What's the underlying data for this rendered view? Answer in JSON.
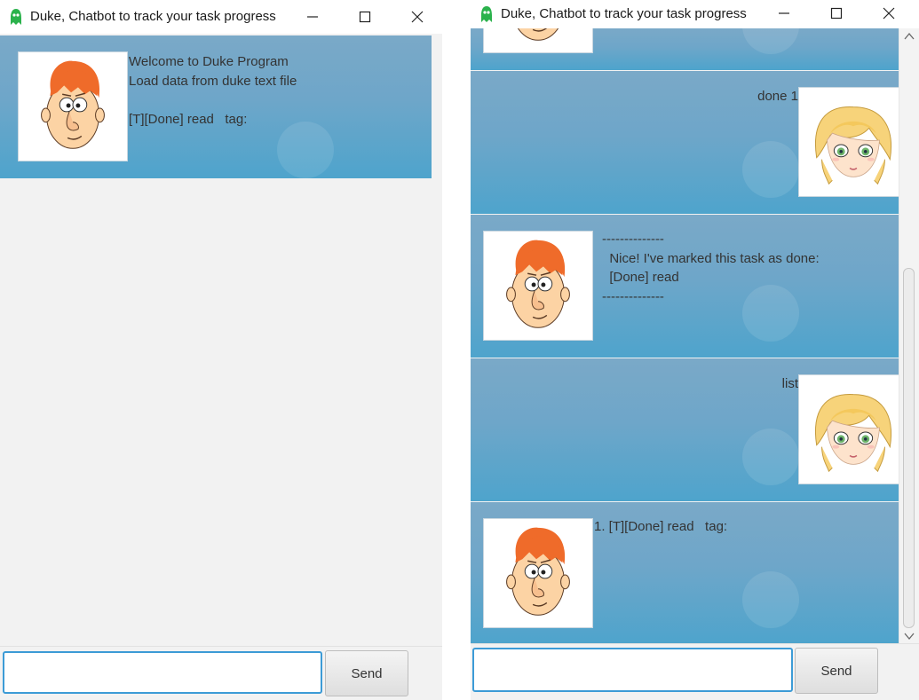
{
  "left_window": {
    "title": "Duke, Chatbot to track your task progress",
    "messages": [
      {
        "sender": "duke",
        "avatar": "duke-avatar",
        "text": "Welcome to Duke Program\nLoad data from duke text file\n\n[T][Done] read   tag:"
      }
    ],
    "input": {
      "value": "",
      "placeholder": ""
    },
    "send_label": "Send"
  },
  "right_window": {
    "title": "Duke, Chatbot to track your task progress",
    "messages": [
      {
        "sender": "user",
        "avatar": "user-avatar",
        "text": "done 1"
      },
      {
        "sender": "duke",
        "avatar": "duke-avatar",
        "text": "--------------\n  Nice! I've marked this task as done:\n  [Done] read\n--------------"
      },
      {
        "sender": "user",
        "avatar": "user-avatar",
        "text": "list"
      },
      {
        "sender": "duke",
        "avatar": "duke-avatar",
        "text": "1. [T][Done] read   tag:"
      }
    ],
    "input": {
      "value": "",
      "placeholder": ""
    },
    "send_label": "Send"
  },
  "icons": [
    "app-icon",
    "minimize-icon",
    "maximize-icon",
    "close-icon",
    "scroll-up-icon",
    "scroll-down-icon"
  ],
  "colors": {
    "dialog_bg": "#6ea6c9",
    "input_focus_border": "#3c9bd6",
    "app_icon": "#2bb24c"
  }
}
